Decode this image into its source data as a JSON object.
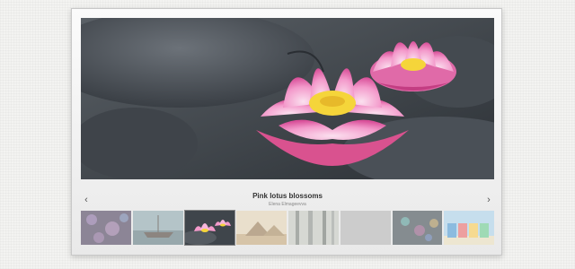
{
  "slider": {
    "caption_title": "Pink lotus blossoms",
    "caption_author": "Elena Elmageevva",
    "prev_arrow": "‹",
    "next_arrow": "›",
    "thumbnails": [
      {
        "subject": "bokeh-lights",
        "active": false
      },
      {
        "subject": "boat",
        "active": false
      },
      {
        "subject": "lotus",
        "active": true
      },
      {
        "subject": "pyramids",
        "active": false
      },
      {
        "subject": "bamboo",
        "active": false
      },
      {
        "subject": "gray-sky",
        "active": false
      },
      {
        "subject": "colorful-bokeh",
        "active": false
      },
      {
        "subject": "beach-huts",
        "active": false
      }
    ]
  },
  "colors": {
    "petal": "#f07fc0",
    "petal_light": "#f9c4e3",
    "stamen": "#f5d53a",
    "water": "#3c4248"
  }
}
